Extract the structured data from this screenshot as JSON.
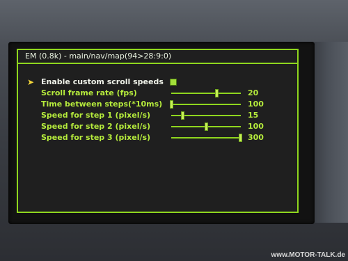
{
  "window": {
    "title": "EM (0.8k) - main/nav/map(94>28:9:0)"
  },
  "menu": {
    "cursor_icon": "arrow-right-icon",
    "rows": [
      {
        "label": "Enable custom scroll speeds",
        "type": "checkbox",
        "checked": true
      },
      {
        "label": "Scroll frame rate (fps)",
        "type": "slider",
        "value": "20",
        "fraction": 0.65
      },
      {
        "label": "Time between steps(*10ms)",
        "type": "slider",
        "value": "100",
        "fraction": 0.0
      },
      {
        "label": "Speed for step 1 (pixel/s)",
        "type": "slider",
        "value": "15",
        "fraction": 0.16
      },
      {
        "label": "Speed for step 2 (pixel/s)",
        "type": "slider",
        "value": "100",
        "fraction": 0.5
      },
      {
        "label": "Speed for step 3 (pixel/s)",
        "type": "slider",
        "value": "300",
        "fraction": 0.99
      }
    ]
  },
  "colors": {
    "accent": "#8fd61e",
    "text": "#b6ec3c",
    "cursor": "#f4d73a"
  },
  "watermark": "www.MOTOR-TALK.de"
}
